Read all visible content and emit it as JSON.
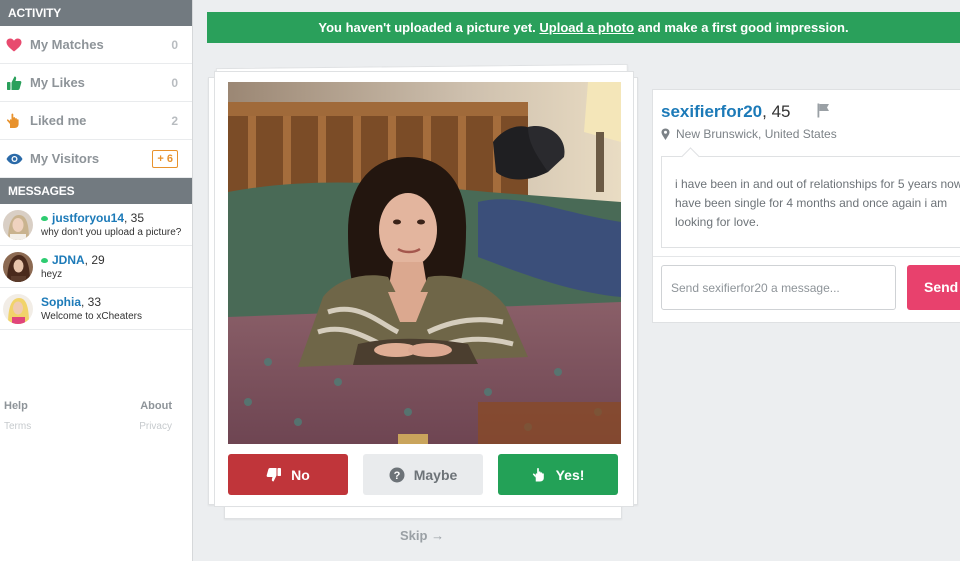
{
  "sidebar": {
    "activity_header": "ACTIVITY",
    "activity": [
      {
        "label": "My Matches",
        "count": "0",
        "icon": "heart-icon",
        "color": "#e84a6e"
      },
      {
        "label": "My Likes",
        "count": "0",
        "icon": "thumbs-up-icon",
        "color": "#2aa05b"
      },
      {
        "label": "Liked me",
        "count": "2",
        "icon": "hand-icon",
        "color": "#e8922d"
      },
      {
        "label": "My Visitors",
        "badge": "+ 6",
        "icon": "eye-icon",
        "color": "#2b6aa8"
      }
    ],
    "messages_header": "MESSAGES",
    "messages": [
      {
        "name": "justforyou14",
        "age": ", 35",
        "snippet": "why don't you upload a picture?",
        "online": true
      },
      {
        "name": "JDNA",
        "age": ", 29",
        "snippet": "heyz",
        "online": true
      },
      {
        "name": "Sophia",
        "age": ", 33",
        "snippet": "Welcome to xCheaters",
        "online": false
      }
    ],
    "footer": {
      "help": "Help",
      "about": "About",
      "terms": "Terms",
      "privacy": "Privacy"
    }
  },
  "banner": {
    "prefix": "You haven't uploaded a picture yet. ",
    "link": "Upload a photo",
    "suffix": " and make a first good impression.",
    "color": "#2aa05b"
  },
  "actions": {
    "no": "No",
    "maybe": "Maybe",
    "yes": "Yes!",
    "skip": "Skip →"
  },
  "profile": {
    "username": "sexifierfor20",
    "age": ", 45",
    "location": "New Brunswick, United States",
    "bio": "i have been in and out of relationships for 5 years now. i have been single for 4 months and once again i am looking for love.",
    "message_placeholder": "Send sexifierfor20 a message...",
    "send": "Send"
  }
}
